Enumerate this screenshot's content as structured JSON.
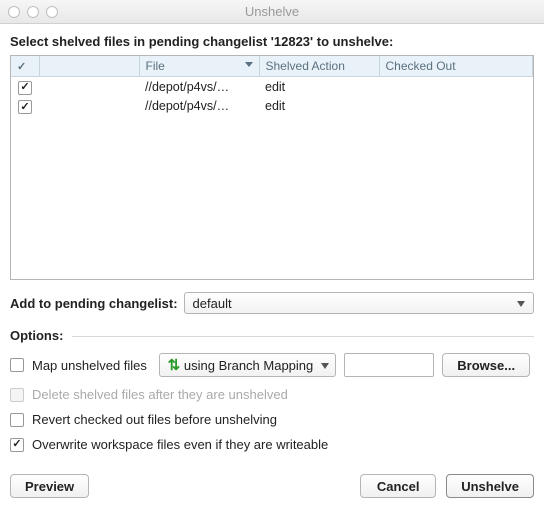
{
  "window": {
    "title": "Unshelve"
  },
  "instruction": "Select shelved files in pending changelist '12823' to unshelve:",
  "table": {
    "headers": {
      "file": "File",
      "shelved_action": "Shelved Action",
      "checked_out": "Checked Out"
    },
    "rows": [
      {
        "checked": true,
        "file": "//depot/p4vs/…",
        "action": "edit",
        "checked_out": ""
      },
      {
        "checked": true,
        "file": "//depot/p4vs/…",
        "action": "edit",
        "checked_out": ""
      }
    ]
  },
  "add_to": {
    "label": "Add to pending changelist:",
    "value": "default"
  },
  "options": {
    "legend": "Options:",
    "map": {
      "checked": false,
      "label": "Map unshelved files"
    },
    "branch_method": "using Branch Mapping",
    "branch_value": "",
    "browse": "Browse...",
    "delete_after": {
      "checked": false,
      "disabled": true,
      "label": "Delete shelved files after they are unshelved"
    },
    "revert": {
      "checked": false,
      "label": "Revert checked out files before unshelving"
    },
    "overwrite": {
      "checked": true,
      "label": "Overwrite workspace files even if they are writeable"
    }
  },
  "buttons": {
    "preview": "Preview",
    "cancel": "Cancel",
    "unshelve": "Unshelve"
  }
}
